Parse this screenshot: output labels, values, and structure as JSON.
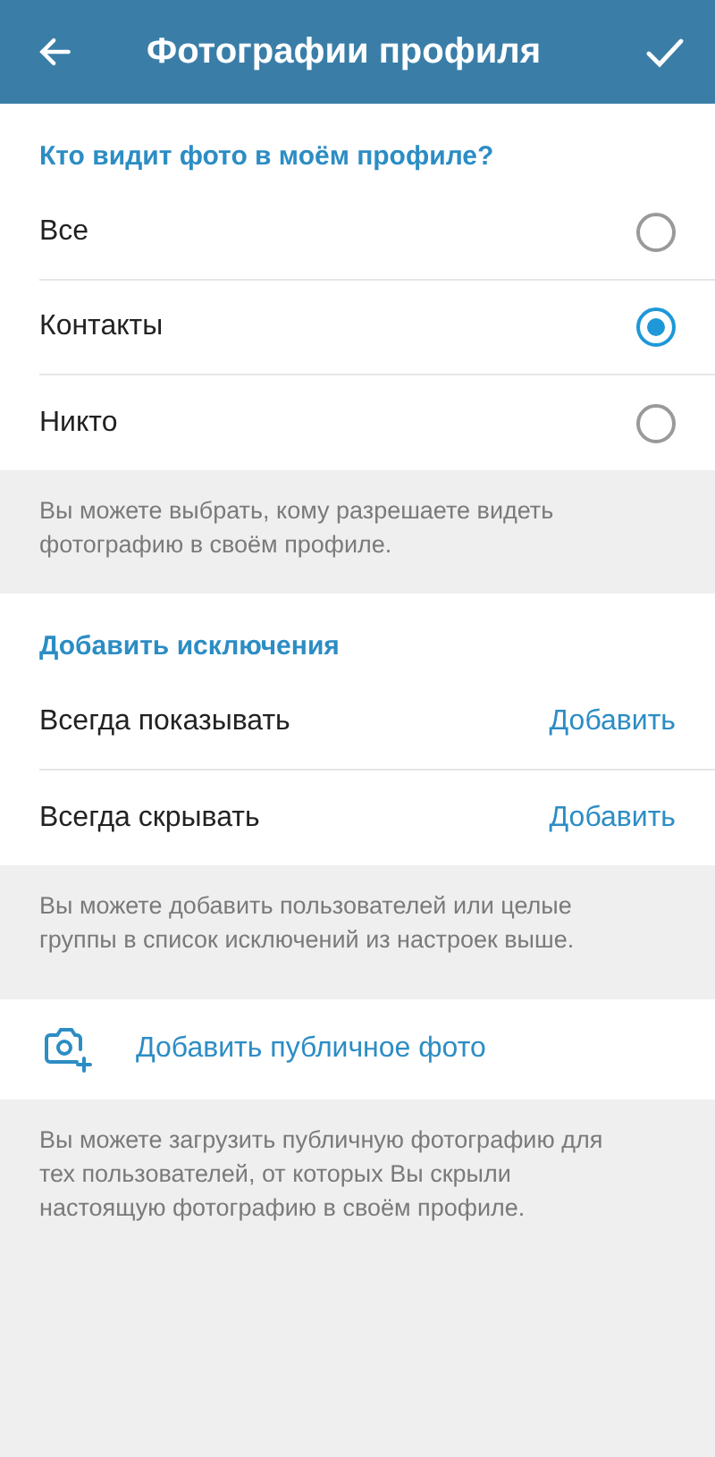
{
  "header": {
    "title": "Фотографии профиля"
  },
  "visibility": {
    "heading": "Кто видит фото в моём профиле?",
    "options": [
      {
        "label": "Все",
        "selected": false
      },
      {
        "label": "Контакты",
        "selected": true
      },
      {
        "label": "Никто",
        "selected": false
      }
    ],
    "hint": "Вы можете выбрать, кому разрешаете видеть фотографию в своём профиле."
  },
  "exceptions": {
    "heading": "Добавить исключения",
    "rows": [
      {
        "label": "Всегда показывать",
        "action": "Добавить"
      },
      {
        "label": "Всегда скрывать",
        "action": "Добавить"
      }
    ],
    "hint": "Вы можете добавить пользователей или целые группы в список исключений из настроек выше."
  },
  "public_photo": {
    "label": "Добавить публичное фото",
    "hint": "Вы можете загрузить публичную фотографию для тех пользователей, от которых Вы скрыли настоящую фотографию в своём профиле."
  }
}
